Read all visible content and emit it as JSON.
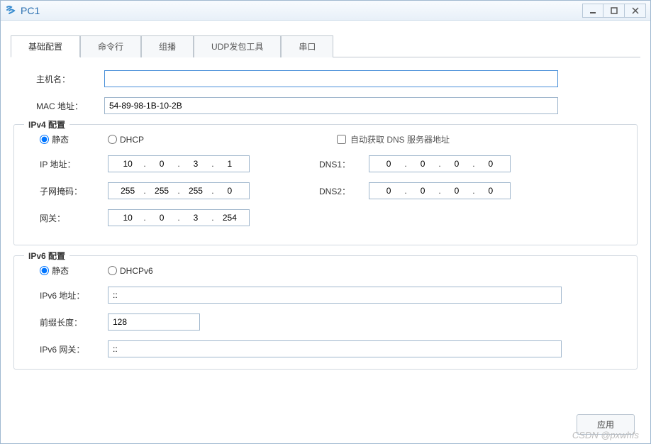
{
  "window": {
    "title": "PC1"
  },
  "tabs": [
    {
      "label": "基础配置",
      "active": true
    },
    {
      "label": "命令行",
      "active": false
    },
    {
      "label": "组播",
      "active": false
    },
    {
      "label": "UDP发包工具",
      "active": false
    },
    {
      "label": "串口",
      "active": false
    }
  ],
  "basic": {
    "hostname_label": "主机名：",
    "hostname_value": "",
    "mac_label": "MAC 地址：",
    "mac_value": "54-89-98-1B-10-2B"
  },
  "ipv4": {
    "legend": "IPv4 配置",
    "static_label": "静态",
    "dhcp_label": "DHCP",
    "autodns_label": "自动获取 DNS 服务器地址",
    "mode": "static",
    "ip_label": "IP 地址：",
    "ip": [
      "10",
      "0",
      "3",
      "1"
    ],
    "mask_label": "子网掩码：",
    "mask": [
      "255",
      "255",
      "255",
      "0"
    ],
    "gw_label": "网关：",
    "gw": [
      "10",
      "0",
      "3",
      "254"
    ],
    "dns1_label": "DNS1：",
    "dns1": [
      "0",
      "0",
      "0",
      "0"
    ],
    "dns2_label": "DNS2：",
    "dns2": [
      "0",
      "0",
      "0",
      "0"
    ]
  },
  "ipv6": {
    "legend": "IPv6 配置",
    "static_label": "静态",
    "dhcp_label": "DHCPv6",
    "mode": "static",
    "addr_label": "IPv6 地址：",
    "addr_value": "::",
    "prefix_label": "前缀长度：",
    "prefix_value": "128",
    "gw_label": "IPv6 网关：",
    "gw_value": "::"
  },
  "actions": {
    "apply": "应用"
  },
  "watermark": "CSDN @pxwhfs"
}
